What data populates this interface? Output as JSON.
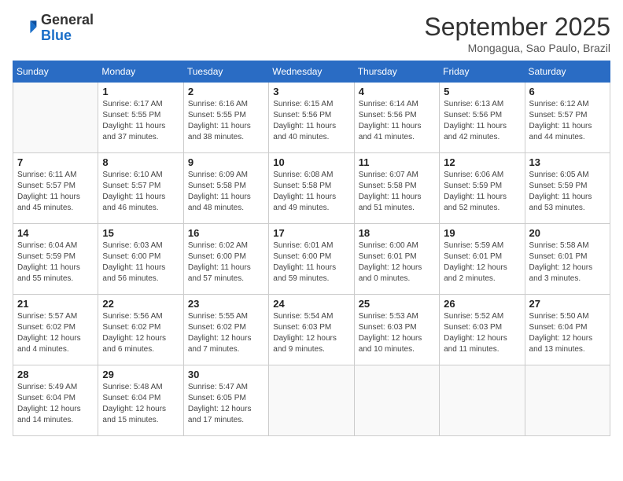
{
  "header": {
    "logo_line1": "General",
    "logo_line2": "Blue",
    "month": "September 2025",
    "location": "Mongagua, Sao Paulo, Brazil"
  },
  "weekdays": [
    "Sunday",
    "Monday",
    "Tuesday",
    "Wednesday",
    "Thursday",
    "Friday",
    "Saturday"
  ],
  "weeks": [
    [
      {
        "day": "",
        "info": ""
      },
      {
        "day": "1",
        "info": "Sunrise: 6:17 AM\nSunset: 5:55 PM\nDaylight: 11 hours\nand 37 minutes."
      },
      {
        "day": "2",
        "info": "Sunrise: 6:16 AM\nSunset: 5:55 PM\nDaylight: 11 hours\nand 38 minutes."
      },
      {
        "day": "3",
        "info": "Sunrise: 6:15 AM\nSunset: 5:56 PM\nDaylight: 11 hours\nand 40 minutes."
      },
      {
        "day": "4",
        "info": "Sunrise: 6:14 AM\nSunset: 5:56 PM\nDaylight: 11 hours\nand 41 minutes."
      },
      {
        "day": "5",
        "info": "Sunrise: 6:13 AM\nSunset: 5:56 PM\nDaylight: 11 hours\nand 42 minutes."
      },
      {
        "day": "6",
        "info": "Sunrise: 6:12 AM\nSunset: 5:57 PM\nDaylight: 11 hours\nand 44 minutes."
      }
    ],
    [
      {
        "day": "7",
        "info": "Sunrise: 6:11 AM\nSunset: 5:57 PM\nDaylight: 11 hours\nand 45 minutes."
      },
      {
        "day": "8",
        "info": "Sunrise: 6:10 AM\nSunset: 5:57 PM\nDaylight: 11 hours\nand 46 minutes."
      },
      {
        "day": "9",
        "info": "Sunrise: 6:09 AM\nSunset: 5:58 PM\nDaylight: 11 hours\nand 48 minutes."
      },
      {
        "day": "10",
        "info": "Sunrise: 6:08 AM\nSunset: 5:58 PM\nDaylight: 11 hours\nand 49 minutes."
      },
      {
        "day": "11",
        "info": "Sunrise: 6:07 AM\nSunset: 5:58 PM\nDaylight: 11 hours\nand 51 minutes."
      },
      {
        "day": "12",
        "info": "Sunrise: 6:06 AM\nSunset: 5:59 PM\nDaylight: 11 hours\nand 52 minutes."
      },
      {
        "day": "13",
        "info": "Sunrise: 6:05 AM\nSunset: 5:59 PM\nDaylight: 11 hours\nand 53 minutes."
      }
    ],
    [
      {
        "day": "14",
        "info": "Sunrise: 6:04 AM\nSunset: 5:59 PM\nDaylight: 11 hours\nand 55 minutes."
      },
      {
        "day": "15",
        "info": "Sunrise: 6:03 AM\nSunset: 6:00 PM\nDaylight: 11 hours\nand 56 minutes."
      },
      {
        "day": "16",
        "info": "Sunrise: 6:02 AM\nSunset: 6:00 PM\nDaylight: 11 hours\nand 57 minutes."
      },
      {
        "day": "17",
        "info": "Sunrise: 6:01 AM\nSunset: 6:00 PM\nDaylight: 11 hours\nand 59 minutes."
      },
      {
        "day": "18",
        "info": "Sunrise: 6:00 AM\nSunset: 6:01 PM\nDaylight: 12 hours\nand 0 minutes."
      },
      {
        "day": "19",
        "info": "Sunrise: 5:59 AM\nSunset: 6:01 PM\nDaylight: 12 hours\nand 2 minutes."
      },
      {
        "day": "20",
        "info": "Sunrise: 5:58 AM\nSunset: 6:01 PM\nDaylight: 12 hours\nand 3 minutes."
      }
    ],
    [
      {
        "day": "21",
        "info": "Sunrise: 5:57 AM\nSunset: 6:02 PM\nDaylight: 12 hours\nand 4 minutes."
      },
      {
        "day": "22",
        "info": "Sunrise: 5:56 AM\nSunset: 6:02 PM\nDaylight: 12 hours\nand 6 minutes."
      },
      {
        "day": "23",
        "info": "Sunrise: 5:55 AM\nSunset: 6:02 PM\nDaylight: 12 hours\nand 7 minutes."
      },
      {
        "day": "24",
        "info": "Sunrise: 5:54 AM\nSunset: 6:03 PM\nDaylight: 12 hours\nand 9 minutes."
      },
      {
        "day": "25",
        "info": "Sunrise: 5:53 AM\nSunset: 6:03 PM\nDaylight: 12 hours\nand 10 minutes."
      },
      {
        "day": "26",
        "info": "Sunrise: 5:52 AM\nSunset: 6:03 PM\nDaylight: 12 hours\nand 11 minutes."
      },
      {
        "day": "27",
        "info": "Sunrise: 5:50 AM\nSunset: 6:04 PM\nDaylight: 12 hours\nand 13 minutes."
      }
    ],
    [
      {
        "day": "28",
        "info": "Sunrise: 5:49 AM\nSunset: 6:04 PM\nDaylight: 12 hours\nand 14 minutes."
      },
      {
        "day": "29",
        "info": "Sunrise: 5:48 AM\nSunset: 6:04 PM\nDaylight: 12 hours\nand 15 minutes."
      },
      {
        "day": "30",
        "info": "Sunrise: 5:47 AM\nSunset: 6:05 PM\nDaylight: 12 hours\nand 17 minutes."
      },
      {
        "day": "",
        "info": ""
      },
      {
        "day": "",
        "info": ""
      },
      {
        "day": "",
        "info": ""
      },
      {
        "day": "",
        "info": ""
      }
    ]
  ]
}
